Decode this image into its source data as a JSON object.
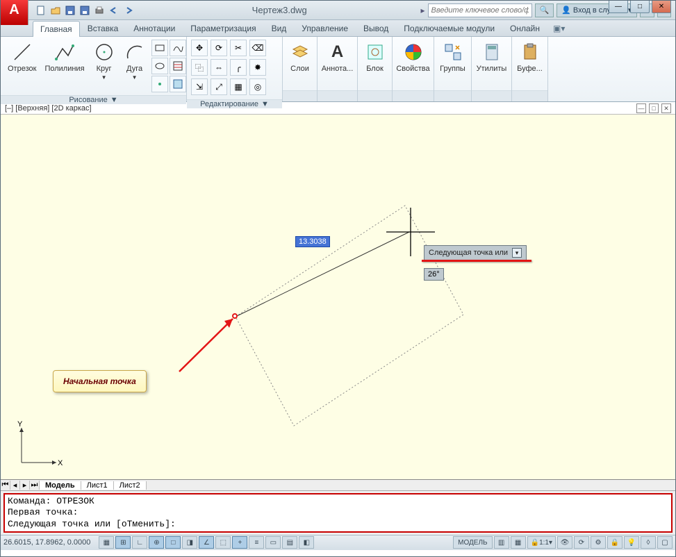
{
  "title": "Чертеж3.dwg",
  "search_placeholder": "Введите ключевое слово/фразу",
  "signin_label": "Вход в службы",
  "tabs": [
    "Главная",
    "Вставка",
    "Аннотации",
    "Параметризация",
    "Вид",
    "Управление",
    "Вывод",
    "Подключаемые модули",
    "Онлайн"
  ],
  "active_tab_index": 0,
  "draw_panel": {
    "title": "Рисование",
    "items": [
      "Отрезок",
      "Полилиния",
      "Круг",
      "Дуга"
    ]
  },
  "edit_panel": {
    "title": "Редактирование"
  },
  "panels_right": [
    "Слои",
    "Аннота...",
    "Блок",
    "Свойства",
    "Группы",
    "Утилиты",
    "Буфе..."
  ],
  "viewport_label": "[–] [Верхняя] [2D каркас]",
  "dimension_value": "13.3038",
  "angle_value": "26°",
  "tooltip_text": "Следующая точка или",
  "callout_text": "Начальная точка",
  "nav_tabs": [
    "Модель",
    "Лист1",
    "Лист2"
  ],
  "command_history": "Команда: ОТРЕЗОК\nПервая точка:",
  "command_prompt": "Следующая точка или [оТменить]:",
  "status_coords": "26.6015, 17.8962, 0.0000",
  "status_model": "МОДЕЛЬ",
  "status_scale": "1:1"
}
